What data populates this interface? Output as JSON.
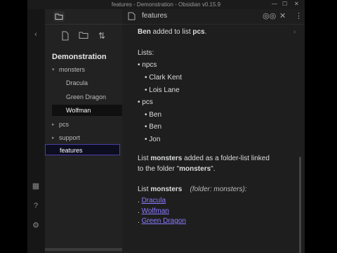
{
  "window": {
    "title": "features - Demonstration - Obsidian v0.15.9"
  },
  "sidebar": {
    "vault_name": "Demonstration",
    "tree": [
      {
        "label": "monsters",
        "type": "folder",
        "expanded": true
      },
      {
        "label": "Dracula",
        "type": "file"
      },
      {
        "label": "Green Dragon",
        "type": "file"
      },
      {
        "label": "Wolfman",
        "type": "file"
      },
      {
        "label": "pcs",
        "type": "folder",
        "expanded": false
      },
      {
        "label": "support",
        "type": "folder",
        "expanded": false
      },
      {
        "label": "features",
        "type": "file",
        "active": true
      }
    ]
  },
  "editor": {
    "tab_title": "features",
    "line1_bold": "Ben",
    "line1_text": " added to list ",
    "line1_bold2": "pcs",
    "line1_end": ".",
    "lists_label": "Lists:",
    "npcs": "npcs",
    "npcs_items": [
      "Clark Kent",
      "Lois Lane"
    ],
    "pcs": "pcs",
    "pcs_items": [
      "Ben",
      "Ben",
      "Jon"
    ],
    "added_a": "List ",
    "added_b": "monsters",
    "added_c": " added as a folder-list linked",
    "added_d": "to the folder \"",
    "added_e": "monsters",
    "added_f": "\".",
    "list_title_a": "List ",
    "list_title_b": "monsters",
    "list_meta": "(folder: monsters):",
    "links": [
      "Dracula",
      "Wolfman",
      "Green Dragon"
    ]
  }
}
